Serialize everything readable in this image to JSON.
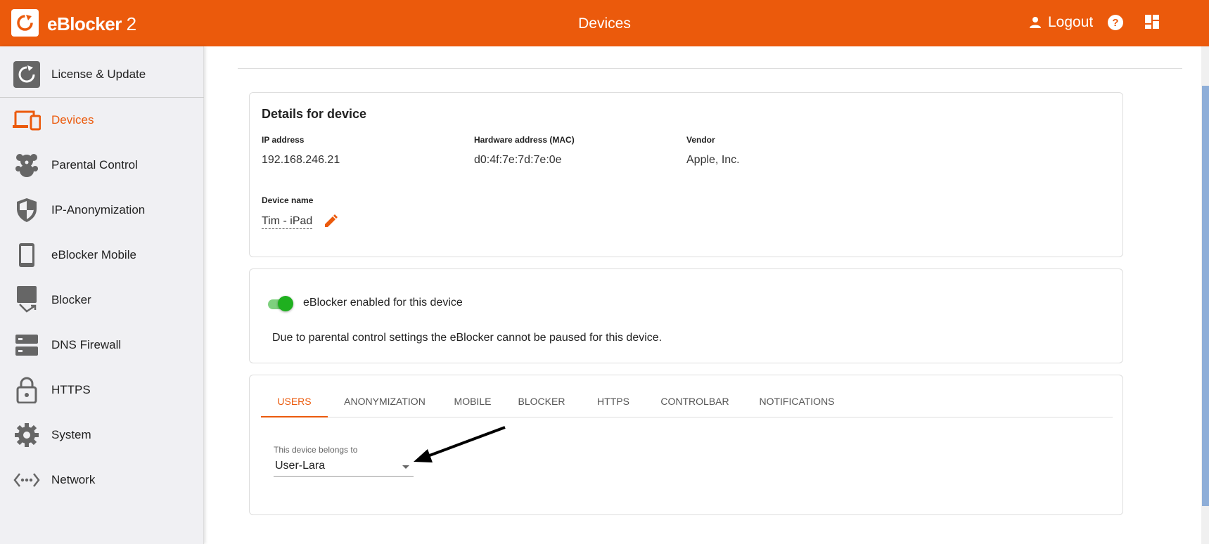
{
  "header": {
    "app_name": "eBlocker",
    "app_version": " 2",
    "page_title": "Devices",
    "logout_label": "Logout",
    "accent_color": "#eb5a0c"
  },
  "sidebar": {
    "items": [
      {
        "label": "License & Update",
        "icon": "license-update-icon"
      },
      {
        "label": "Devices",
        "icon": "devices-icon",
        "active": true
      },
      {
        "label": "Parental Control",
        "icon": "teddy-bear-icon"
      },
      {
        "label": "IP-Anonymization",
        "icon": "shield-icon"
      },
      {
        "label": "eBlocker Mobile",
        "icon": "smartphone-icon"
      },
      {
        "label": "Blocker",
        "icon": "blocker-icon"
      },
      {
        "label": "DNS Firewall",
        "icon": "server-icon"
      },
      {
        "label": "HTTPS",
        "icon": "lock-icon"
      },
      {
        "label": "System",
        "icon": "gear-icon"
      },
      {
        "label": "Network",
        "icon": "network-icon"
      }
    ]
  },
  "details": {
    "title": "Details for device",
    "ip_label": "IP address",
    "ip_value": "192.168.246.21",
    "mac_label": "Hardware address (MAC)",
    "mac_value": "d0:4f:7e:7d:7e:0e",
    "vendor_label": "Vendor",
    "vendor_value": "Apple, Inc.",
    "name_label": "Device name",
    "name_value": "Tim - iPad"
  },
  "status": {
    "toggle_label": "eBlocker enabled for this device",
    "toggle_on": true,
    "notice": "Due to parental control settings the eBlocker cannot be paused for this device."
  },
  "tabs": [
    {
      "label": "USERS",
      "active": true
    },
    {
      "label": "ANONYMIZATION"
    },
    {
      "label": "MOBILE"
    },
    {
      "label": "BLOCKER"
    },
    {
      "label": "HTTPS"
    },
    {
      "label": "CONTROLBAR"
    },
    {
      "label": "NOTIFICATIONS"
    }
  ],
  "users_tab": {
    "select_label": "This device belongs to",
    "selected_user": "User-Lara"
  }
}
